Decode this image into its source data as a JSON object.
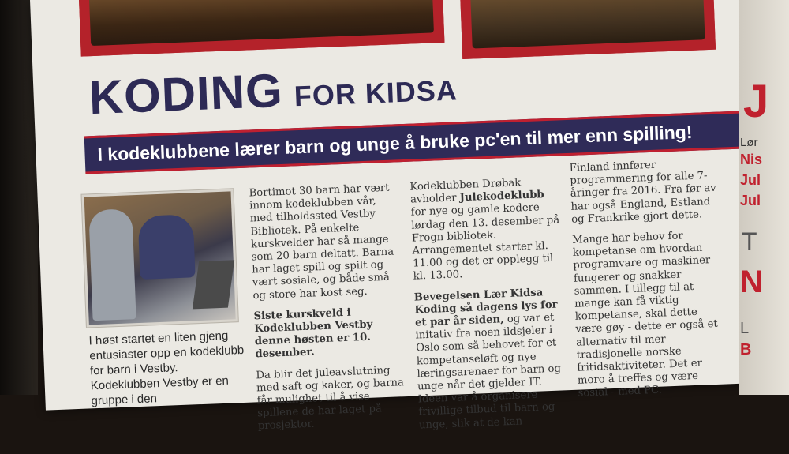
{
  "article": {
    "title_main": "KODING",
    "title_sub": "FOR KIDSA",
    "banner": "I kodeklubbene lærer barn og unge å bruke pc'en til mer enn spilling!",
    "caption": "I høst startet en liten gjeng entusiaster opp en kodeklubb for barn i Vestby. Kodeklubben Vestby er en gruppe i den",
    "col1": {
      "p1": "Bortimot 30 barn har vært innom kodeklubben vår, med tilholdssted Vestby Bibliotek. På enkelte kurskvelder har så mange som 20 barn deltatt. Barna har laget spill og spilt og vært sosiale, og både små og store har kost seg.",
      "p2_bold": "Siste kurskveld i Kodeklubben Vestby denne høsten er 10. desember.",
      "p3": "Da blir det juleavslutning med saft og kaker, og barna får mulighet til å vise spillene de har laget på prosjektor."
    },
    "col2": {
      "p1_lead": "Kodeklubben Drøbak avholder ",
      "p1_bold": "Julekodeklubb",
      "p1_rest": " for nye og gamle kodere lørdag den 13. desember på Frogn bibliotek. Arrangementet starter kl. 11.00 og det er opplegg til kl. 13.00.",
      "p2_bold": "Bevegelsen Lær Kidsa Koding så dagens lys for et par år siden,",
      "p2_rest": " og var et initativ fra noen ildsjeler i Oslo som så behovet for et kompetanseløft og nye læringsarenaer for barn og unge når det gjelder IT. Ideen var å organisere frivillige tilbud til barn og unge, slik at de kan"
    },
    "col3": {
      "p1": "Finland innfører programmering for alle 7-åringer fra 2016. Fra før av har også England, Estland og Frankrike gjort dette.",
      "p2": "Mange har behov for kompetanse om hvordan programvare og maskiner fungerer og snakker sammen. I tillegg til at mange kan få viktig kompetanse, skal dette være gøy - dette er også et alternativ til mer tradisjonelle norske fritidsaktiviteter. Det er moro å treffes og være sosial - med PC."
    },
    "right_page_fragments": [
      "J",
      "Lør",
      "Nis",
      "Jul",
      "Jul",
      "T",
      "N",
      "L",
      "B"
    ]
  },
  "colors": {
    "banner_bg": "#2f2b58",
    "banner_border": "#bf2030",
    "title": "#2d2a55",
    "frame_red": "#b4222a",
    "paper": "#ebe9e3"
  }
}
